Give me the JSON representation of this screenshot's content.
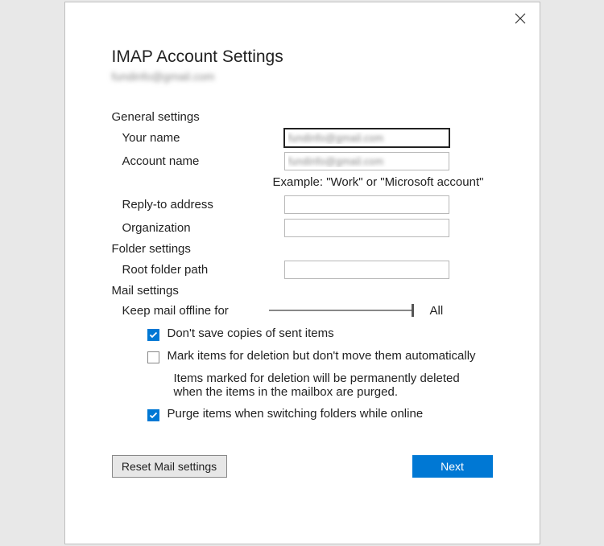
{
  "dialog": {
    "title": "IMAP Account Settings",
    "account_email": "fundinfo@gmail.com"
  },
  "general": {
    "header": "General settings",
    "your_name_label": "Your name",
    "your_name_value": "fundinfo@gmail.com",
    "account_name_label": "Account name",
    "account_name_value": "fundinfo@gmail.com",
    "account_name_hint": "Example: \"Work\" or \"Microsoft account\"",
    "reply_to_label": "Reply-to address",
    "reply_to_value": "",
    "organization_label": "Organization",
    "organization_value": ""
  },
  "folder": {
    "header": "Folder settings",
    "root_path_label": "Root folder path",
    "root_path_value": ""
  },
  "mail": {
    "header": "Mail settings",
    "keep_offline_label": "Keep mail offline for",
    "keep_offline_value": "All",
    "dont_save_label": "Don't save copies of sent items",
    "mark_delete_label": "Mark items for deletion but don't move them automatically",
    "mark_delete_help": "Items marked for deletion will be permanently deleted when the items in the mailbox are purged.",
    "purge_label": "Purge items when switching folders while online"
  },
  "buttons": {
    "reset": "Reset Mail settings",
    "next": "Next"
  }
}
